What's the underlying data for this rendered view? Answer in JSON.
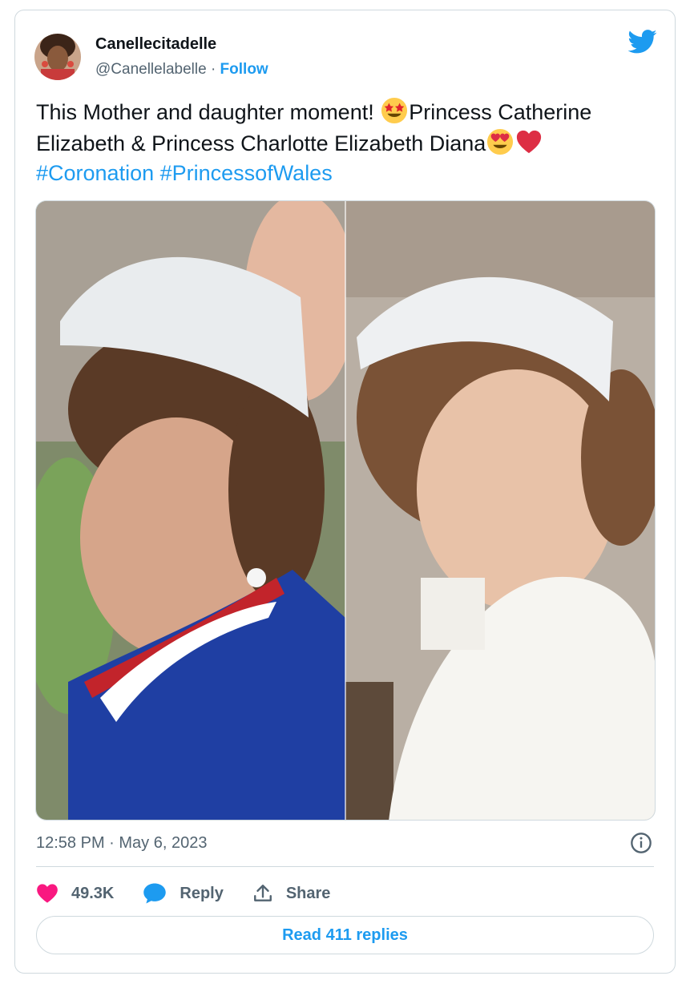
{
  "user": {
    "display_name": "Canellecitadelle",
    "handle": "@Canellelabelle",
    "separator": "·",
    "follow_label": "Follow"
  },
  "tweet": {
    "text_part1": "This Mother and daughter moment! ",
    "text_part2": "Princess Catherine Elizabeth & Princess Charlotte Elizabeth Diana",
    "hashtag1": "#Coronation",
    "hashtag2": "#PrincessofWales",
    "emojis": [
      "star-struck-emoji",
      "heart-eyes-emoji",
      "red-heart-emoji"
    ],
    "timestamp": "12:58 PM · May 6, 2023"
  },
  "actions": {
    "likes": "49.3K",
    "reply_label": "Reply",
    "share_label": "Share",
    "read_replies_label": "Read 411 replies"
  },
  "colors": {
    "accent": "#1d9bf0",
    "like": "#f91880",
    "border": "#cfd9de",
    "muted": "#536471"
  }
}
